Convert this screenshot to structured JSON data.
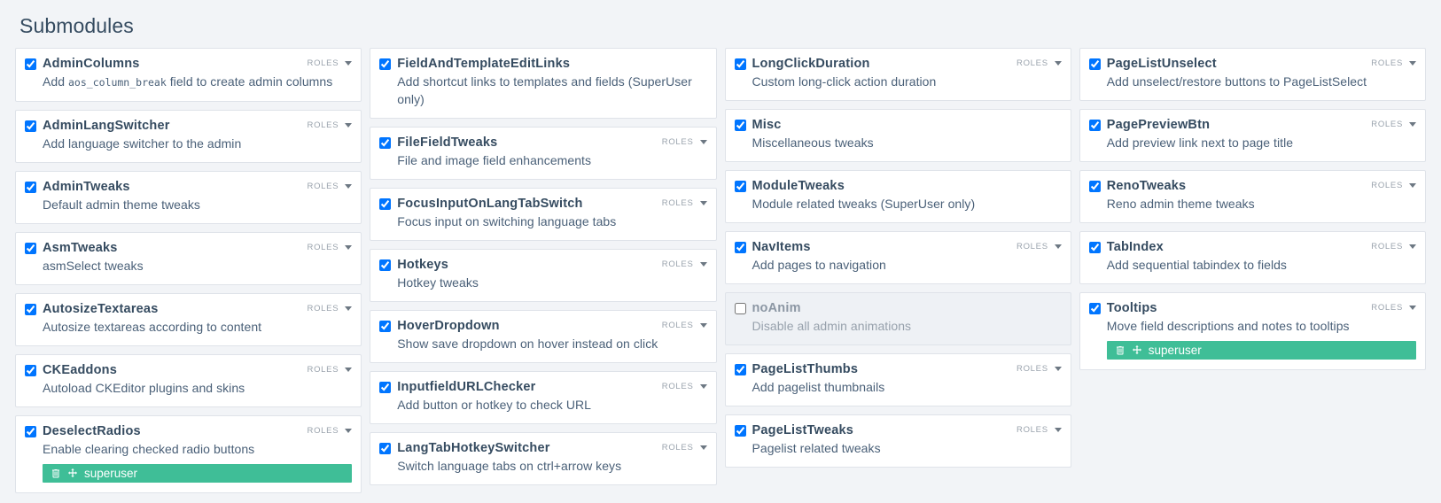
{
  "page": {
    "title": "Submodules",
    "accent_green": "#3fbe97",
    "background": "#f2f4f7",
    "card_background": "#ffffff",
    "disabled_card_background": "#eef1f5",
    "border_color": "#dfe3e9",
    "heading_color": "#354b60",
    "roles_label": "ROLES",
    "caret_icon": "chevron-down-icon",
    "delete_icon": "trash-icon",
    "drag_icon": "move-arrows-icon"
  },
  "columns": [
    {
      "cards": [
        {
          "name": "AdminColumns",
          "desc_before": "Add ",
          "desc_code": "aos_column_break",
          "desc_after": " field to create admin columns",
          "checked": true,
          "has_roles": true,
          "tags": []
        },
        {
          "name": "AdminLangSwitcher",
          "description": "Add language switcher to the admin",
          "checked": true,
          "has_roles": true,
          "tags": []
        },
        {
          "name": "AdminTweaks",
          "description": "Default admin theme tweaks",
          "checked": true,
          "has_roles": true,
          "tags": []
        },
        {
          "name": "AsmTweaks",
          "description": "asmSelect tweaks",
          "checked": true,
          "has_roles": true,
          "tags": []
        },
        {
          "name": "AutosizeTextareas",
          "description": "Autosize textareas according to content",
          "checked": true,
          "has_roles": true,
          "tags": []
        },
        {
          "name": "CKEaddons",
          "description": "Autoload CKEditor plugins and skins",
          "checked": true,
          "has_roles": true,
          "tags": []
        },
        {
          "name": "DeselectRadios",
          "description": "Enable clearing checked radio buttons",
          "checked": true,
          "has_roles": true,
          "tags": [
            "superuser"
          ]
        }
      ]
    },
    {
      "cards": [
        {
          "name": "FieldAndTemplateEditLinks",
          "description": "Add shortcut links to templates and fields (SuperUser only)",
          "checked": true,
          "has_roles": false,
          "tags": []
        },
        {
          "name": "FileFieldTweaks",
          "description": "File and image field enhancements",
          "checked": true,
          "has_roles": true,
          "tags": []
        },
        {
          "name": "FocusInputOnLangTabSwitch",
          "description": "Focus input on switching language tabs",
          "checked": true,
          "has_roles": true,
          "tags": []
        },
        {
          "name": "Hotkeys",
          "description": "Hotkey tweaks",
          "checked": true,
          "has_roles": true,
          "tags": []
        },
        {
          "name": "HoverDropdown",
          "description": "Show save dropdown on hover instead on click",
          "checked": true,
          "has_roles": true,
          "tags": []
        },
        {
          "name": "InputfieldURLChecker",
          "description": "Add button or hotkey to check URL",
          "checked": true,
          "has_roles": true,
          "tags": []
        },
        {
          "name": "LangTabHotkeySwitcher",
          "description": "Switch language tabs on ctrl+arrow keys",
          "checked": true,
          "has_roles": true,
          "tags": []
        }
      ]
    },
    {
      "cards": [
        {
          "name": "LongClickDuration",
          "description": "Custom long-click action duration",
          "checked": true,
          "has_roles": true,
          "tags": []
        },
        {
          "name": "Misc",
          "description": "Miscellaneous tweaks",
          "checked": true,
          "has_roles": false,
          "tags": []
        },
        {
          "name": "ModuleTweaks",
          "description": "Module related tweaks (SuperUser only)",
          "checked": true,
          "has_roles": false,
          "tags": []
        },
        {
          "name": "NavItems",
          "description": "Add pages to navigation",
          "checked": true,
          "has_roles": true,
          "tags": []
        },
        {
          "name": "noAnim",
          "description": "Disable all admin animations",
          "checked": false,
          "has_roles": false,
          "tags": []
        },
        {
          "name": "PageListThumbs",
          "description": "Add pagelist thumbnails",
          "checked": true,
          "has_roles": true,
          "tags": []
        },
        {
          "name": "PageListTweaks",
          "description": "Pagelist related tweaks",
          "checked": true,
          "has_roles": true,
          "tags": []
        }
      ]
    },
    {
      "cards": [
        {
          "name": "PageListUnselect",
          "description": "Add unselect/restore buttons to PageListSelect",
          "checked": true,
          "has_roles": true,
          "tags": []
        },
        {
          "name": "PagePreviewBtn",
          "description": "Add preview link next to page title",
          "checked": true,
          "has_roles": true,
          "tags": []
        },
        {
          "name": "RenoTweaks",
          "description": "Reno admin theme tweaks",
          "checked": true,
          "has_roles": true,
          "tags": []
        },
        {
          "name": "TabIndex",
          "description": "Add sequential tabindex to fields",
          "checked": true,
          "has_roles": true,
          "tags": []
        },
        {
          "name": "Tooltips",
          "description": "Move field descriptions and notes to tooltips",
          "checked": true,
          "has_roles": true,
          "tags": [
            "superuser"
          ]
        }
      ]
    }
  ]
}
